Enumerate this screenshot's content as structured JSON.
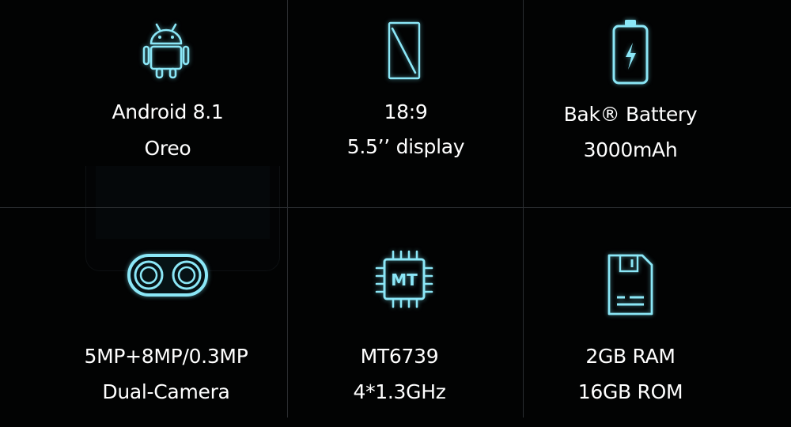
{
  "accent_color": "#8be7f7",
  "features": [
    {
      "icon": "android-robot-icon",
      "line1": "Android 8.1",
      "line2": "Oreo"
    },
    {
      "icon": "phone-display-icon",
      "line1": "18:9",
      "line2": "5.5’’ display"
    },
    {
      "icon": "battery-bolt-icon",
      "line1": "Bak® Battery",
      "line2": "3000mAh"
    },
    {
      "icon": "dual-camera-icon",
      "line1": "5MP+8MP/0.3MP",
      "line2": "Dual-Camera"
    },
    {
      "icon": "mt-chip-icon",
      "chip_label": "MT",
      "line1": "MT6739",
      "line2": "4*1.3GHz"
    },
    {
      "icon": "sd-card-icon",
      "line1": "2GB RAM",
      "line2": "16GB ROM"
    }
  ]
}
